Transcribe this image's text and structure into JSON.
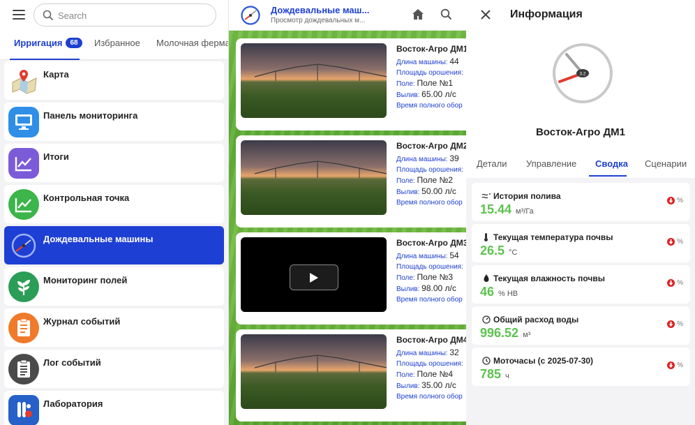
{
  "search": {
    "placeholder": "Search"
  },
  "tabs": [
    {
      "label": "Ирригация",
      "badge": "68"
    },
    {
      "label": "Избранное"
    },
    {
      "label": "Молочная ферма"
    }
  ],
  "menu": [
    {
      "label": "Карта",
      "icon": "map-icon"
    },
    {
      "label": "Панель мониторинга",
      "icon": "monitor-icon"
    },
    {
      "label": "Итоги",
      "icon": "chart-icon"
    },
    {
      "label": "Контрольная точка",
      "icon": "checkpoint-chart-icon"
    },
    {
      "label": "Дождевальные машины",
      "icon": "sprinkler-icon"
    },
    {
      "label": "Мониторинг полей",
      "icon": "plant-icon"
    },
    {
      "label": "Журнал событий",
      "icon": "journal-icon"
    },
    {
      "label": "Лог событий",
      "icon": "log-icon"
    },
    {
      "label": "Лаборатория",
      "icon": "lab-icon"
    }
  ],
  "middle": {
    "title": "Дождевальные маш...",
    "subtitle": "Просмотр дождевальных м...",
    "cards": [
      {
        "name": "Восток-Агро ДМ1",
        "length_label": "Длина машины:",
        "length": "44",
        "area_label": "Площадь орошения:",
        "field_label": "Поле:",
        "field": "Поле №1",
        "flow_label": "Вылив:",
        "flow": "65.00 л/с",
        "cycle_label": "Время полного обор"
      },
      {
        "name": "Восток-Агро ДМ2",
        "length_label": "Длина машины:",
        "length": "39",
        "area_label": "Площадь орошения:",
        "field_label": "Поле:",
        "field": "Поле №2",
        "flow_label": "Вылив:",
        "flow": "50.00 л/с",
        "cycle_label": "Время полного обор"
      },
      {
        "name": "Восток-Агро ДМ3",
        "length_label": "Длина машины:",
        "length": "54",
        "area_label": "Площадь орошения:",
        "field_label": "Поле:",
        "field": "Поле №3",
        "flow_label": "Вылив:",
        "flow": "98.00 л/с",
        "cycle_label": "Время полного обор"
      },
      {
        "name": "Восток-Агро ДМ4",
        "length_label": "Длина машины:",
        "length": "32",
        "area_label": "Площадь орошения:",
        "field_label": "Поле:",
        "field": "Поле №4",
        "flow_label": "Вылив:",
        "flow": "35.00 л/с",
        "cycle_label": "Время полного обор"
      }
    ]
  },
  "info": {
    "title": "Информация",
    "gauge_value": "3.2",
    "machine_name": "Восток-Агро ДМ1",
    "tabs": [
      "Детали",
      "Управление",
      "Сводка",
      "Сценарии"
    ],
    "active_tab": "Сводка",
    "stats": [
      {
        "label": "История полива",
        "value": "15.44",
        "unit": "м³/Га",
        "trend": "%",
        "icon": "watering-icon"
      },
      {
        "label": "Текущая температура почвы",
        "value": "26.5",
        "unit": "°C",
        "trend": "%",
        "icon": "thermometer-icon"
      },
      {
        "label": "Текущая влажность почвы",
        "value": "46",
        "unit": "% HB",
        "trend": "%",
        "icon": "droplet-icon"
      },
      {
        "label": "Общий расход воды",
        "value": "996.52",
        "unit": "м³",
        "trend": "%",
        "icon": "gauge-icon"
      },
      {
        "label": "Моточасы (с 2025-07-30)",
        "value": "785",
        "unit": "ч",
        "trend": "%",
        "icon": "clock-icon"
      }
    ]
  },
  "colors": {
    "accent": "#1e40d0",
    "value_green": "#5cc34e",
    "trend_red": "#e02020"
  }
}
